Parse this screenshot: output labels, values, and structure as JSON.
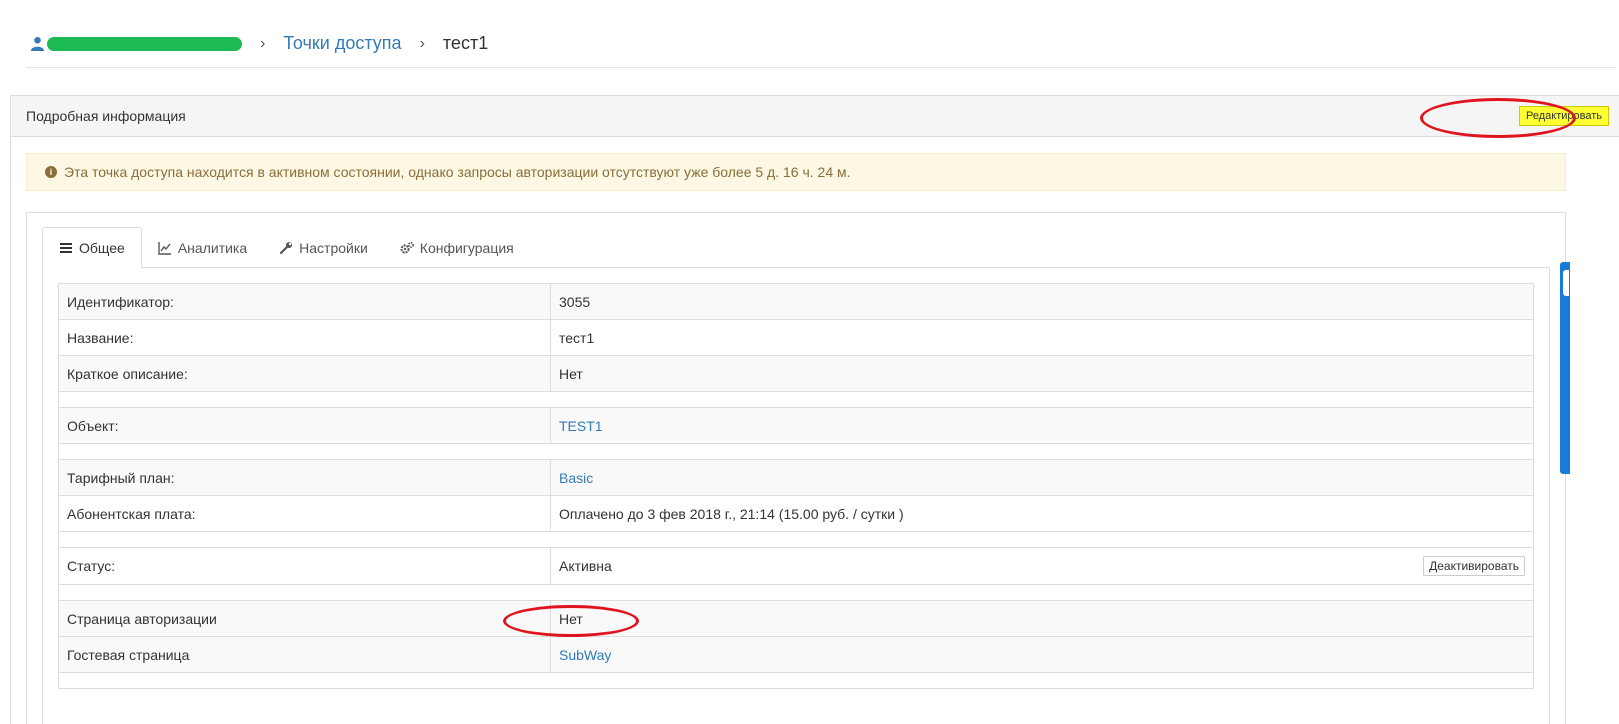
{
  "breadcrumb": {
    "section": "Точки доступа",
    "current": "тест1",
    "separator": "›"
  },
  "panel": {
    "title": "Подробная информация",
    "edit_label": "Редактировать"
  },
  "alert": {
    "icon": "info-icon",
    "text": "Эта точка доступа находится в активном состоянии, однако запросы авторизации отсутствуют уже более 5 д. 16 ч. 24 м."
  },
  "tabs": [
    {
      "label": "Общее",
      "icon": "bars-icon",
      "active": true
    },
    {
      "label": "Аналитика",
      "icon": "line-chart-icon",
      "active": false
    },
    {
      "label": "Настройки",
      "icon": "wrench-icon",
      "active": false
    },
    {
      "label": "Конфигурация",
      "icon": "cogs-icon",
      "active": false
    }
  ],
  "details": {
    "id_label": "Идентификатор:",
    "id_value": "3055",
    "name_label": "Название:",
    "name_value": "тест1",
    "desc_label": "Краткое описание:",
    "desc_value": "Нет",
    "object_label": "Объект:",
    "object_value": "TEST1",
    "plan_label": "Тарифный план:",
    "plan_value": "Basic",
    "fee_label": "Абонентская плата:",
    "fee_value": "Оплачено до 3 фев 2018 г., 21:14 (15.00 руб. / сутки )",
    "status_label": "Статус:",
    "status_value": "Активна",
    "deactivate_label": "Деактивировать",
    "auth_page_label": "Страница авторизации",
    "auth_page_value": "Нет",
    "guest_page_label": "Гостевая страница",
    "guest_page_value": "SubWay"
  },
  "colors": {
    "link": "#337ab7",
    "alert_bg": "#fcf8e3",
    "alert_text": "#8a6d3b",
    "highlight": "#ffff33",
    "annotation": "#e0141e"
  }
}
